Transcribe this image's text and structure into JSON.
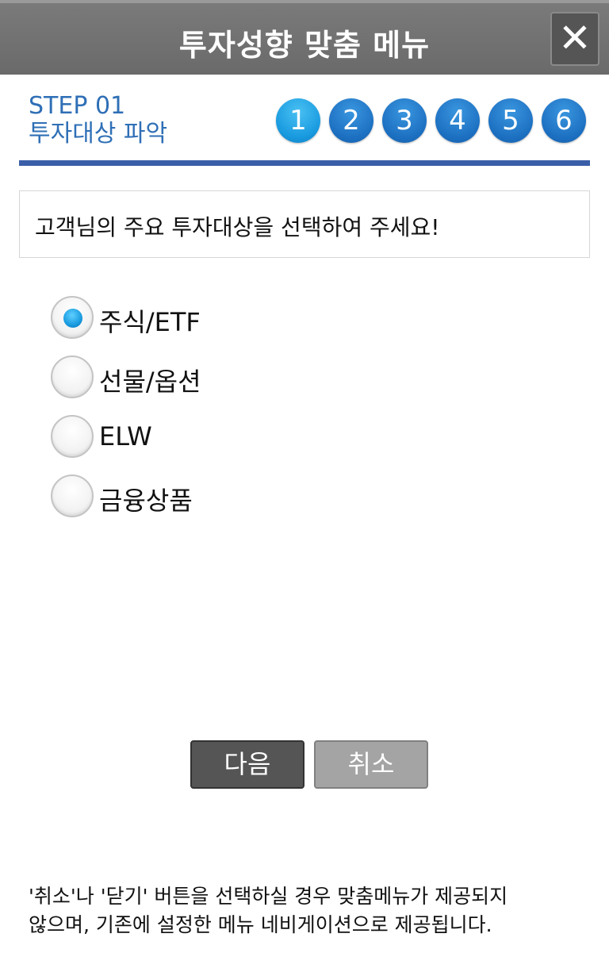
{
  "header": {
    "title": "투자성향 맞춤 메뉴",
    "close_label": "✕"
  },
  "step": {
    "number_label": "STEP 01",
    "name": "투자대상 파악",
    "indicators": [
      "1",
      "2",
      "3",
      "4",
      "5",
      "6"
    ],
    "current": 1,
    "colors": {
      "active": "#1a9be0",
      "inactive": "#1c6fc0",
      "rule": "#3a5ea8"
    }
  },
  "prompt": "고객님의 주요 투자대상을 선택하여 주세요!",
  "options": [
    {
      "label": "주식/ETF",
      "checked": true
    },
    {
      "label": "선물/옵션",
      "checked": false
    },
    {
      "label": "ELW",
      "checked": false
    },
    {
      "label": "금융상품",
      "checked": false
    }
  ],
  "buttons": {
    "next_label": "다음",
    "cancel_label": "취소"
  },
  "notice": {
    "line1": "'취소'나 '닫기' 버튼을 선택하실 경우 맞춤메뉴가 제공되지",
    "line2": "않으며, 기존에 설정한 메뉴 네비게이션으로 제공됩니다."
  },
  "icons": {
    "close": "close-icon",
    "radio_selected": "radio-checked-icon",
    "radio_unselected": "radio-unchecked-icon"
  }
}
